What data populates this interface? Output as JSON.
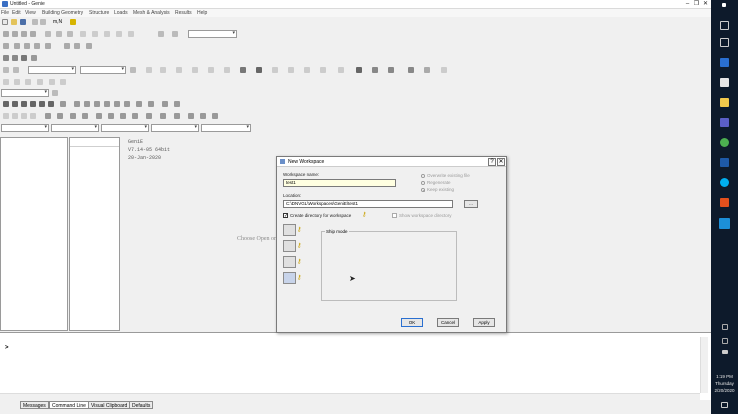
{
  "window": {
    "title": "Untitled - Genie",
    "minimize": "–",
    "restore": "❐",
    "close": "✕"
  },
  "menu": [
    "File",
    "Edit",
    "View",
    "Building Geometry",
    "Structure",
    "Loads",
    "Mesh & Analysis",
    "Results",
    "Help"
  ],
  "toolbar": {
    "units_label": "m,N"
  },
  "main": {
    "info_line1": "GeniE",
    "info_line2": "V7.14-05 64bit",
    "info_line3": "20-Jan-2020",
    "canvas_hint": "Choose Open or"
  },
  "output": {
    "prompt": ">"
  },
  "tabs": [
    "Messages",
    "Command Line",
    "Visual Clipboard",
    "Defaults"
  ],
  "dialog": {
    "title": "New Workspace",
    "help_button": "?",
    "close_button": "✕",
    "workspace_name_label": "Workspace name:",
    "workspace_name_value": "test1",
    "location_label": "Location:",
    "location_value": "C:\\DNVGL\\Workspaces\\GeniE\\test1",
    "browse_label": "...",
    "radio_overwrite": "Overwrite existing file",
    "radio_regenerate": "Regenerate",
    "radio_keep": "Keep existing",
    "create_dir_label": "Create directory for workspace",
    "show_dir_label": "Show workspace directory",
    "ship_mode_label": "Ship mode",
    "ok": "OK",
    "cancel": "Cancel",
    "apply": "Apply"
  },
  "taskbar": {
    "time": "1:19 PM",
    "day": "Thursday",
    "date": "2/20/2020"
  },
  "colors": {
    "accent": "#2a6fd0",
    "taskbar": "#0d1a2b",
    "workspace_name_bg": "#ffffe1"
  }
}
